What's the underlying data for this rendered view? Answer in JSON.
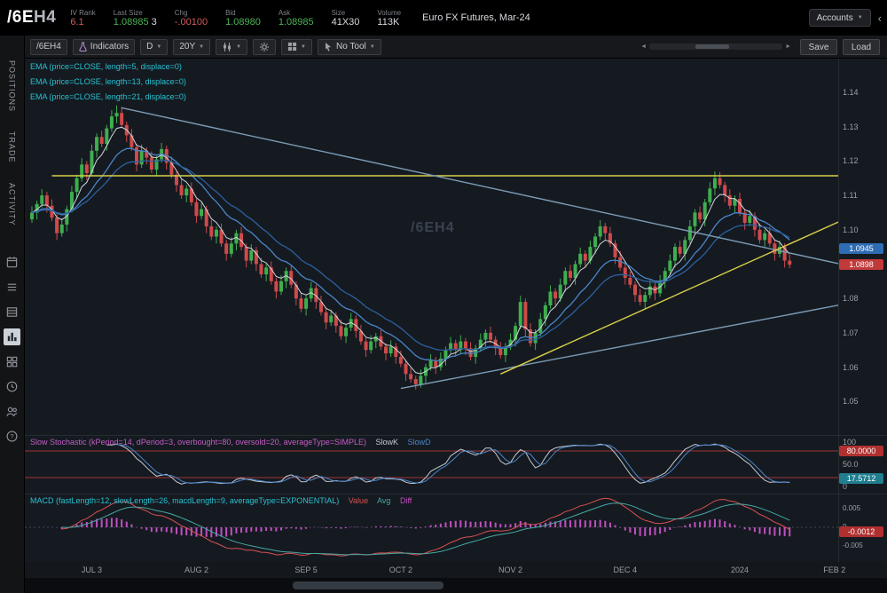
{
  "header": {
    "symbol_root": "/6E",
    "symbol_contract": "H4",
    "iv_rank_label": "IV Rank",
    "iv_rank": "6.1",
    "last_label": "Last Size",
    "last": "1.08985",
    "last_size": "3",
    "chg_label": "Chg",
    "chg": "-.00100",
    "bid_label": "Bid",
    "bid": "1.08980",
    "ask_label": "Ask",
    "ask": "1.08985",
    "size_label": "Size",
    "size": "41X30",
    "volume_label": "Volume",
    "volume": "113K",
    "description": "Euro FX Futures, Mar-24",
    "accounts_label": "Accounts"
  },
  "toolbar": {
    "symbol_tab": "/6EH4",
    "indicators_label": "Indicators",
    "timeframe": "D",
    "range": "20Y",
    "tool_label": "No Tool",
    "save_label": "Save",
    "load_label": "Load"
  },
  "sidebar": {
    "tabs": [
      {
        "label": "POSITIONS"
      },
      {
        "label": "TRADE"
      },
      {
        "label": "ACTIVITY"
      }
    ],
    "icons": [
      {
        "name": "calendar-icon"
      },
      {
        "name": "list-icon"
      },
      {
        "name": "rows-icon"
      },
      {
        "name": "chart-gadget-icon",
        "active": true
      },
      {
        "name": "grid-icon"
      },
      {
        "name": "clock-icon"
      },
      {
        "name": "users-icon"
      },
      {
        "name": "help-icon"
      }
    ]
  },
  "chart_data": {
    "type": "candlestick",
    "symbol": "/6EH4",
    "watermark": "/6EH4",
    "up_color": "#3fae4e",
    "down_color": "#cf4a4a",
    "ema_label_color": "#29c2d1",
    "price_axis_ticks": [
      1.14,
      1.13,
      1.12,
      1.11,
      1.1,
      1.09,
      1.08,
      1.07,
      1.06,
      1.05
    ],
    "price_badges": [
      {
        "text": "1.0945",
        "color": "#2e6db4",
        "price": 1.0945
      },
      {
        "text": "1.0898",
        "color": "#c13a3a",
        "price": 1.0898
      }
    ],
    "time_axis": [
      {
        "label": "JUL 3",
        "bar": 12
      },
      {
        "label": "AUG 2",
        "bar": 33
      },
      {
        "label": "SEP 5",
        "bar": 55
      },
      {
        "label": "OCT 2",
        "bar": 74
      },
      {
        "label": "NOV 2",
        "bar": 96
      },
      {
        "label": "DEC 4",
        "bar": 119
      },
      {
        "label": "2024",
        "bar": 142
      },
      {
        "label": "FEB 2",
        "bar": 161
      }
    ],
    "drawings": [
      {
        "name": "resistance-hline",
        "type": "horizontal",
        "color": "#d8cf4a",
        "from_bar": 4,
        "price": 1.1157
      },
      {
        "name": "descending-trendline",
        "type": "segment",
        "color": "#7d9cb5",
        "from": {
          "bar": 18,
          "price": 1.1355
        },
        "to": {
          "bar": 166,
          "price": 1.0888
        }
      },
      {
        "name": "ascending-trendline",
        "type": "segment",
        "color": "#7d9cb5",
        "from": {
          "bar": 74,
          "price": 1.0538
        },
        "to": {
          "bar": 166,
          "price": 1.0792
        }
      },
      {
        "name": "yellow-trendline",
        "type": "segment",
        "color": "#d8cf4a",
        "from": {
          "bar": 94,
          "price": 1.058
        },
        "to": {
          "bar": 166,
          "price": 1.105
        }
      }
    ],
    "studies": {
      "emas": [
        {
          "label": "EMA (price=CLOSE, length=5, displace=0)",
          "length": 5,
          "color": "#d2d6dc"
        },
        {
          "label": "EMA (price=CLOSE, length=13, displace=0)",
          "length": 13,
          "color": "#4a86c8"
        },
        {
          "label": "EMA (price=CLOSE, length=21, displace=0)",
          "length": 21,
          "color": "#2c5f9e"
        }
      ],
      "stochastic": {
        "label": "Slow Stochastic (kPeriod=14, dPeriod=3, overbought=80, oversold=20, averageType=SIMPLE)",
        "label_color": "#c45ec4",
        "kPeriod": 14,
        "dPeriod": 3,
        "overbought": 80,
        "oversold": 20,
        "levels_color": "#9e3434",
        "plots": [
          {
            "name": "SlowK",
            "color": "#c4cbd4"
          },
          {
            "name": "SlowD",
            "color": "#4a86c8"
          }
        ],
        "axis_ticks": [
          {
            "text": "100",
            "value": 100
          },
          {
            "text": "50.0",
            "value": 50
          },
          {
            "text": "0",
            "value": 0
          }
        ],
        "badges": [
          {
            "text": "80.0000",
            "color": "#b03030",
            "value": 80
          },
          {
            "text": "17.5712",
            "color": "#207e8e",
            "value": 17.57
          }
        ]
      },
      "macd": {
        "label": "MACD (fastLength=12, slowLength=26, macdLength=9, averageType=EXPONENTIAL)",
        "label_color": "#29c2d1",
        "fastLength": 12,
        "slowLength": 26,
        "macdLength": 9,
        "plots": [
          {
            "name": "Value",
            "color": "#d85050"
          },
          {
            "name": "Avg",
            "color": "#45a8a2"
          },
          {
            "name": "Diff",
            "color": "#c050c0"
          }
        ],
        "axis_ticks": [
          {
            "text": "0.005",
            "value": 0.005
          },
          {
            "text": "0",
            "value": 0
          },
          {
            "text": "-0.005",
            "value": -0.005
          }
        ],
        "badges": [
          {
            "text": "-0.0012",
            "color": "#b03030",
            "value": -0.0012
          }
        ]
      }
    },
    "candles": [
      [
        1.103,
        1.1068,
        1.102,
        1.105
      ],
      [
        1.105,
        1.1085,
        1.103,
        1.1075
      ],
      [
        1.1075,
        1.1118,
        1.1065,
        1.11
      ],
      [
        1.11,
        1.111,
        1.105,
        1.107
      ],
      [
        1.107,
        1.1088,
        1.1025,
        1.1035
      ],
      [
        1.1035,
        1.1045,
        1.097,
        1.099
      ],
      [
        1.099,
        1.1033,
        1.098,
        1.1015
      ],
      [
        1.1015,
        1.107,
        1.0995,
        1.106
      ],
      [
        1.106,
        1.1128,
        1.105,
        1.111
      ],
      [
        1.111,
        1.116,
        1.109,
        1.115
      ],
      [
        1.115,
        1.1208,
        1.114,
        1.119
      ],
      [
        1.119,
        1.12,
        1.1145,
        1.1165
      ],
      [
        1.1165,
        1.1248,
        1.1155,
        1.123
      ],
      [
        1.123,
        1.128,
        1.121,
        1.127
      ],
      [
        1.127,
        1.1288,
        1.124,
        1.125
      ],
      [
        1.125,
        1.1305,
        1.123,
        1.1295
      ],
      [
        1.1295,
        1.1348,
        1.1285,
        1.133
      ],
      [
        1.133,
        1.1362,
        1.131,
        1.134
      ],
      [
        1.134,
        1.1358,
        1.1295,
        1.1305
      ],
      [
        1.1305,
        1.1315,
        1.1255,
        1.1275
      ],
      [
        1.1275,
        1.1293,
        1.123,
        1.124
      ],
      [
        1.124,
        1.125,
        1.117,
        1.119
      ],
      [
        1.119,
        1.1248,
        1.118,
        1.123
      ],
      [
        1.123,
        1.124,
        1.119,
        1.121
      ],
      [
        1.121,
        1.1228,
        1.1165,
        1.1175
      ],
      [
        1.1175,
        1.1215,
        1.1155,
        1.1205
      ],
      [
        1.1205,
        1.1253,
        1.1195,
        1.1235
      ],
      [
        1.1235,
        1.1245,
        1.1175,
        1.1195
      ],
      [
        1.1195,
        1.1213,
        1.115,
        1.116
      ],
      [
        1.116,
        1.117,
        1.111,
        1.113
      ],
      [
        1.113,
        1.1148,
        1.109,
        1.11
      ],
      [
        1.11,
        1.113,
        1.108,
        1.112
      ],
      [
        1.112,
        1.1138,
        1.107,
        1.108
      ],
      [
        1.108,
        1.109,
        1.102,
        1.104
      ],
      [
        1.104,
        1.1078,
        1.103,
        1.106
      ],
      [
        1.106,
        1.107,
        1.099,
        1.101
      ],
      [
        1.101,
        1.1028,
        1.097,
        1.098
      ],
      [
        1.098,
        1.101,
        1.096,
        1.1
      ],
      [
        1.1,
        1.1018,
        1.095,
        1.096
      ],
      [
        1.096,
        1.097,
        1.091,
        1.093
      ],
      [
        1.093,
        1.0978,
        1.092,
        1.096
      ],
      [
        1.096,
        1.1,
        1.094,
        1.099
      ],
      [
        1.099,
        1.1008,
        1.094,
        1.095
      ],
      [
        1.095,
        1.096,
        1.089,
        1.091
      ],
      [
        1.091,
        1.0958,
        1.09,
        1.094
      ],
      [
        1.094,
        1.095,
        1.088,
        1.09
      ],
      [
        1.09,
        1.0918,
        1.086,
        1.087
      ],
      [
        1.087,
        1.09,
        1.085,
        1.089
      ],
      [
        1.089,
        1.0908,
        1.084,
        1.085
      ],
      [
        1.085,
        1.086,
        1.08,
        1.082
      ],
      [
        1.082,
        1.0868,
        1.081,
        1.085
      ],
      [
        1.085,
        1.089,
        1.083,
        1.088
      ],
      [
        1.088,
        1.0898,
        1.083,
        1.084
      ],
      [
        1.084,
        1.085,
        1.078,
        1.08
      ],
      [
        1.08,
        1.0818,
        1.076,
        1.077
      ],
      [
        1.077,
        1.081,
        1.075,
        1.08
      ],
      [
        1.08,
        1.0848,
        1.079,
        1.083
      ],
      [
        1.083,
        1.084,
        1.077,
        1.079
      ],
      [
        1.079,
        1.0808,
        1.075,
        1.076
      ],
      [
        1.076,
        1.077,
        1.071,
        1.073
      ],
      [
        1.073,
        1.0768,
        1.072,
        1.075
      ],
      [
        1.075,
        1.076,
        1.07,
        1.072
      ],
      [
        1.072,
        1.0738,
        1.068,
        1.069
      ],
      [
        1.069,
        1.0725,
        1.067,
        1.0715
      ],
      [
        1.0715,
        1.0758,
        1.0705,
        1.074
      ],
      [
        1.074,
        1.075,
        1.0685,
        1.0705
      ],
      [
        1.0705,
        1.0723,
        1.0665,
        1.0675
      ],
      [
        1.0675,
        1.0685,
        1.063,
        1.065
      ],
      [
        1.065,
        1.0693,
        1.064,
        1.0675
      ],
      [
        1.0675,
        1.07,
        1.0655,
        1.069
      ],
      [
        1.069,
        1.0708,
        1.065,
        1.066
      ],
      [
        1.066,
        1.067,
        1.062,
        1.064
      ],
      [
        1.064,
        1.0678,
        1.063,
        1.066
      ],
      [
        1.066,
        1.067,
        1.061,
        1.063
      ],
      [
        1.063,
        1.0648,
        1.06,
        1.061
      ],
      [
        1.061,
        1.062,
        1.056,
        1.058
      ],
      [
        1.058,
        1.0598,
        1.0555,
        1.0565
      ],
      [
        1.0565,
        1.0575,
        1.0535,
        1.055
      ],
      [
        1.055,
        1.0593,
        1.054,
        1.0575
      ],
      [
        1.0575,
        1.061,
        1.0555,
        1.06
      ],
      [
        1.06,
        1.0638,
        1.059,
        1.062
      ],
      [
        1.062,
        1.063,
        1.058,
        1.06
      ],
      [
        1.06,
        1.0643,
        1.059,
        1.0625
      ],
      [
        1.0625,
        1.066,
        1.0605,
        1.065
      ],
      [
        1.065,
        1.0688,
        1.064,
        1.067
      ],
      [
        1.067,
        1.068,
        1.063,
        1.065
      ],
      [
        1.065,
        1.0693,
        1.064,
        1.0675
      ],
      [
        1.0675,
        1.0685,
        1.0635,
        1.0655
      ],
      [
        1.0655,
        1.0673,
        1.062,
        1.063
      ],
      [
        1.063,
        1.0665,
        1.061,
        1.0655
      ],
      [
        1.0655,
        1.0698,
        1.0645,
        1.068
      ],
      [
        1.068,
        1.071,
        1.066,
        1.07
      ],
      [
        1.07,
        1.0718,
        1.067,
        1.068
      ],
      [
        1.068,
        1.069,
        1.0635,
        1.0655
      ],
      [
        1.0655,
        1.0673,
        1.0625,
        1.0635
      ],
      [
        1.0635,
        1.067,
        1.0615,
        1.066
      ],
      [
        1.066,
        1.0698,
        1.065,
        1.068
      ],
      [
        1.068,
        1.073,
        1.066,
        1.072
      ],
      [
        1.072,
        1.0808,
        1.071,
        1.079
      ],
      [
        1.079,
        1.08,
        1.069,
        1.071
      ],
      [
        1.071,
        1.0728,
        1.066,
        1.067
      ],
      [
        1.067,
        1.071,
        1.065,
        1.07
      ],
      [
        1.07,
        1.0758,
        1.069,
        1.074
      ],
      [
        1.074,
        1.079,
        1.072,
        1.078
      ],
      [
        1.078,
        1.0838,
        1.077,
        1.082
      ],
      [
        1.082,
        1.083,
        1.078,
        1.08
      ],
      [
        1.08,
        1.0858,
        1.079,
        1.084
      ],
      [
        1.084,
        1.089,
        1.082,
        1.088
      ],
      [
        1.088,
        1.0898,
        1.085,
        1.086
      ],
      [
        1.086,
        1.091,
        1.084,
        1.09
      ],
      [
        1.09,
        1.0948,
        1.089,
        1.093
      ],
      [
        1.093,
        1.094,
        1.089,
        1.091
      ],
      [
        1.091,
        1.0968,
        1.09,
        1.095
      ],
      [
        1.095,
        1.099,
        1.093,
        1.098
      ],
      [
        1.098,
        1.1028,
        1.097,
        1.101
      ],
      [
        1.101,
        1.102,
        1.097,
        1.099
      ],
      [
        1.099,
        1.1008,
        1.095,
        1.096
      ],
      [
        1.096,
        1.097,
        1.09,
        1.092
      ],
      [
        1.092,
        1.0938,
        1.088,
        1.089
      ],
      [
        1.089,
        1.09,
        1.084,
        1.086
      ],
      [
        1.086,
        1.0878,
        1.083,
        1.084
      ],
      [
        1.084,
        1.085,
        1.079,
        1.081
      ],
      [
        1.081,
        1.0828,
        1.078,
        1.079
      ],
      [
        1.079,
        1.082,
        1.077,
        1.081
      ],
      [
        1.081,
        1.0853,
        1.08,
        1.0835
      ],
      [
        1.0835,
        1.0845,
        1.0795,
        1.0815
      ],
      [
        1.0815,
        1.0868,
        1.0805,
        1.085
      ],
      [
        1.085,
        1.089,
        1.083,
        1.088
      ],
      [
        1.088,
        1.0928,
        1.087,
        1.091
      ],
      [
        1.091,
        1.096,
        1.089,
        1.095
      ],
      [
        1.095,
        1.0968,
        1.092,
        1.093
      ],
      [
        1.093,
        1.098,
        1.091,
        1.097
      ],
      [
        1.097,
        1.1028,
        1.096,
        1.101
      ],
      [
        1.101,
        1.106,
        1.099,
        1.105
      ],
      [
        1.105,
        1.1068,
        1.102,
        1.103
      ],
      [
        1.103,
        1.109,
        1.101,
        1.108
      ],
      [
        1.108,
        1.1138,
        1.107,
        1.112
      ],
      [
        1.112,
        1.117,
        1.11,
        1.115
      ],
      [
        1.115,
        1.1168,
        1.112,
        1.113
      ],
      [
        1.113,
        1.114,
        1.108,
        1.11
      ],
      [
        1.11,
        1.1118,
        1.106,
        1.107
      ],
      [
        1.107,
        1.11,
        1.105,
        1.109
      ],
      [
        1.109,
        1.1108,
        1.104,
        1.105
      ],
      [
        1.105,
        1.106,
        1.1,
        1.102
      ],
      [
        1.102,
        1.1058,
        1.101,
        1.104
      ],
      [
        1.104,
        1.105,
        1.098,
        1.1
      ],
      [
        1.1,
        1.1018,
        1.096,
        1.097
      ],
      [
        1.097,
        1.1,
        1.095,
        1.099
      ],
      [
        1.099,
        1.1008,
        1.095,
        1.096
      ],
      [
        1.096,
        1.097,
        1.091,
        1.093
      ],
      [
        1.093,
        1.0968,
        1.092,
        1.095
      ],
      [
        1.095,
        1.096,
        1.089,
        1.091
      ],
      [
        1.091,
        1.0928,
        1.0888,
        1.0898
      ]
    ]
  }
}
